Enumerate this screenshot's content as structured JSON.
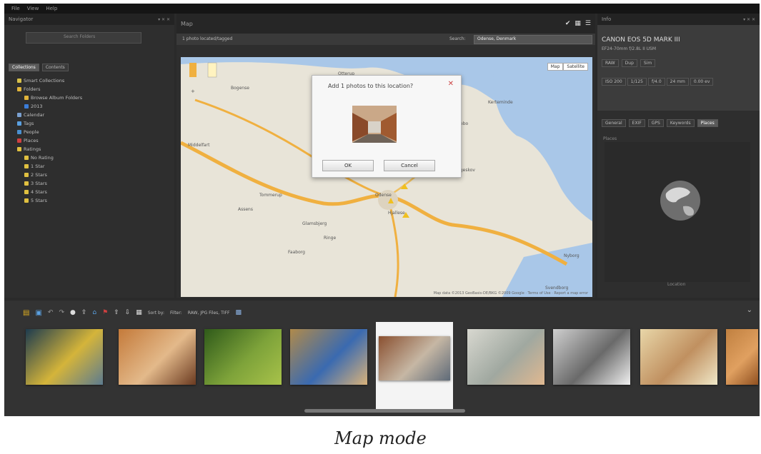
{
  "menu": [
    "File",
    "View",
    "Help"
  ],
  "navigator": {
    "title": "Navigator",
    "search_placeholder": "Search Folders",
    "tabs": [
      "Collections",
      "Contents"
    ],
    "tree": [
      {
        "label": "Smart Collections",
        "color": "#d6c04a"
      },
      {
        "label": "Folders",
        "color": "#e0b43a"
      },
      {
        "label": "Browse Album Folders",
        "color": "#e0b43a"
      },
      {
        "label": "2013",
        "color": "#3b7dd8"
      },
      {
        "label": "Calendar",
        "color": "#7aa0d0"
      },
      {
        "label": "Tags",
        "color": "#5aa0e0"
      },
      {
        "label": "People",
        "color": "#4a90d0"
      },
      {
        "label": "Places",
        "color": "#d04040"
      },
      {
        "label": "Ratings",
        "color": "#e0c040"
      },
      {
        "label": "No Rating",
        "color": "#e0c040"
      },
      {
        "label": "1 Star",
        "color": "#e0c040"
      },
      {
        "label": "2 Stars",
        "color": "#e0c040"
      },
      {
        "label": "3 Stars",
        "color": "#e0c040"
      },
      {
        "label": "4 Stars",
        "color": "#e0c040"
      },
      {
        "label": "5 Stars",
        "color": "#e0c040"
      }
    ]
  },
  "map": {
    "title": "Map",
    "status": "1 photo located/tagged",
    "search_label": "Search:",
    "search_value": "Odense, Denmark",
    "type_buttons": [
      "Map",
      "Satellite"
    ],
    "places": [
      "Odense",
      "Nyborg",
      "Kerteminde",
      "Middelfart",
      "Assens",
      "Faaborg",
      "Svendborg",
      "Ringe",
      "Bogense",
      "Otterup",
      "Munkebo",
      "Langeskov",
      "Hjallese",
      "Tommerup",
      "Glamsbjerg"
    ],
    "footer": "Map data ©2013 GeoBasis-DE/BKG ©2009 Google · Terms of Use · Report a map error"
  },
  "dialog": {
    "title": "Add 1 photos to this location?",
    "ok_label": "OK",
    "cancel_label": "Cancel"
  },
  "info": {
    "title": "Info",
    "camera": "CANON EOS 5D MARK III",
    "lens": "EF24-70mm f/2.8L II USM",
    "badges": [
      "RAW",
      "Dup",
      "Sim"
    ],
    "metrics": [
      "ISO 200",
      "1/125",
      "f/4.0",
      "24 mm",
      "0.00 ev"
    ],
    "tabs": [
      "General",
      "EXIF",
      "GPS",
      "Keywords",
      "Places"
    ],
    "active_tab": "Places",
    "section_label": "Places",
    "globe_caption": "Location"
  },
  "toolbar": {
    "sort_label": "Sort by:",
    "filter_label": "Filter:",
    "format_label": "RAW, JPG Files, TIFF"
  },
  "thumbnails": [
    {
      "name": "mountain-lake",
      "colors": [
        "#1d3b4f",
        "#d4b43a",
        "#5c7b8f"
      ]
    },
    {
      "name": "child-face-paint",
      "colors": [
        "#c47a3a",
        "#e3b98a",
        "#6a3a20"
      ]
    },
    {
      "name": "green-foliage",
      "colors": [
        "#2f5a1a",
        "#7ea33a",
        "#a8c24a"
      ]
    },
    {
      "name": "blue-scooter",
      "colors": [
        "#b08a4a",
        "#3a6ab0",
        "#d9b27a"
      ]
    },
    {
      "name": "street-houses",
      "colors": [
        "#8a5030",
        "#c6b7a4",
        "#5e6a78"
      ]
    },
    {
      "name": "camera-woman",
      "colors": [
        "#d8d8d0",
        "#a0a8a0",
        "#e0b890"
      ]
    },
    {
      "name": "bw-photographer",
      "colors": [
        "#cfcfcf",
        "#6a6a6a",
        "#f0f0f0"
      ]
    },
    {
      "name": "woman-portrait",
      "colors": [
        "#e8d6a8",
        "#c09060",
        "#f0e8c8"
      ]
    },
    {
      "name": "partial-thumb",
      "colors": [
        "#c08040",
        "#e0a060",
        "#905020"
      ]
    }
  ],
  "caption": "Map mode"
}
